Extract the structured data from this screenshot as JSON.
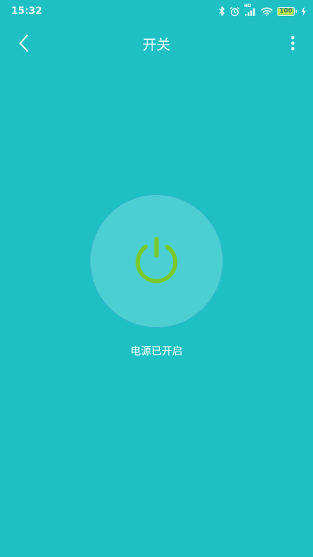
{
  "status_bar": {
    "time": "15:32",
    "network_label": "HD",
    "battery_level": "100",
    "battery_color": "#c8e84a"
  },
  "nav": {
    "title": "开关",
    "back_icon": "chevron-left-icon",
    "more_icon": "more-vertical-icon"
  },
  "power": {
    "icon": "power-icon",
    "icon_color": "#7ac92a",
    "circle_color": "#4bcfd2",
    "status_text": "电源已开启",
    "is_on": true
  },
  "theme": {
    "background": "#1fc0c3",
    "text": "#ffffff"
  }
}
